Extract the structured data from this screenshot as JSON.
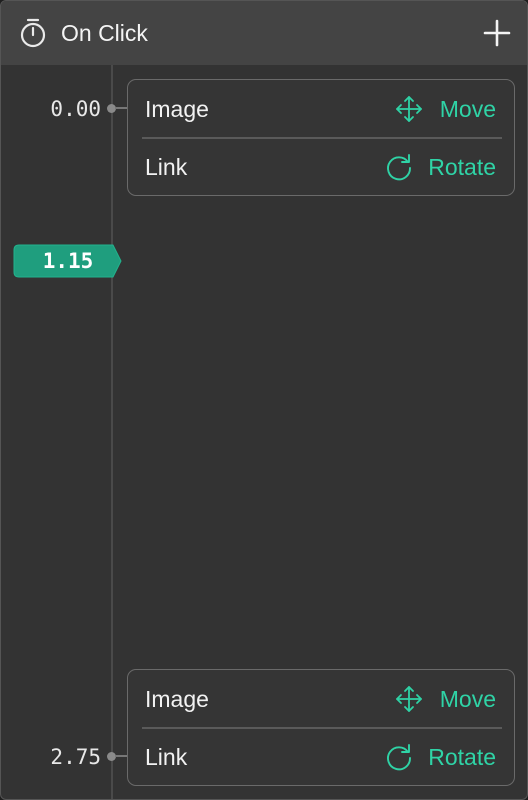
{
  "header": {
    "title": "On Click",
    "timer_icon": "stopwatch-icon",
    "add_icon": "plus-icon"
  },
  "playhead": {
    "time": "1.15",
    "color": "#1f9e7e"
  },
  "accent_color": "#2fd3a6",
  "keyframes": [
    {
      "time": "0.00",
      "rows": [
        {
          "target": "Image",
          "action": "Move",
          "icon": "move-arrows-icon"
        },
        {
          "target": "Link",
          "action": "Rotate",
          "icon": "rotate-icon"
        }
      ]
    },
    {
      "time": "2.75",
      "rows": [
        {
          "target": "Image",
          "action": "Move",
          "icon": "move-arrows-icon"
        },
        {
          "target": "Link",
          "action": "Rotate",
          "icon": "rotate-icon"
        }
      ]
    }
  ]
}
